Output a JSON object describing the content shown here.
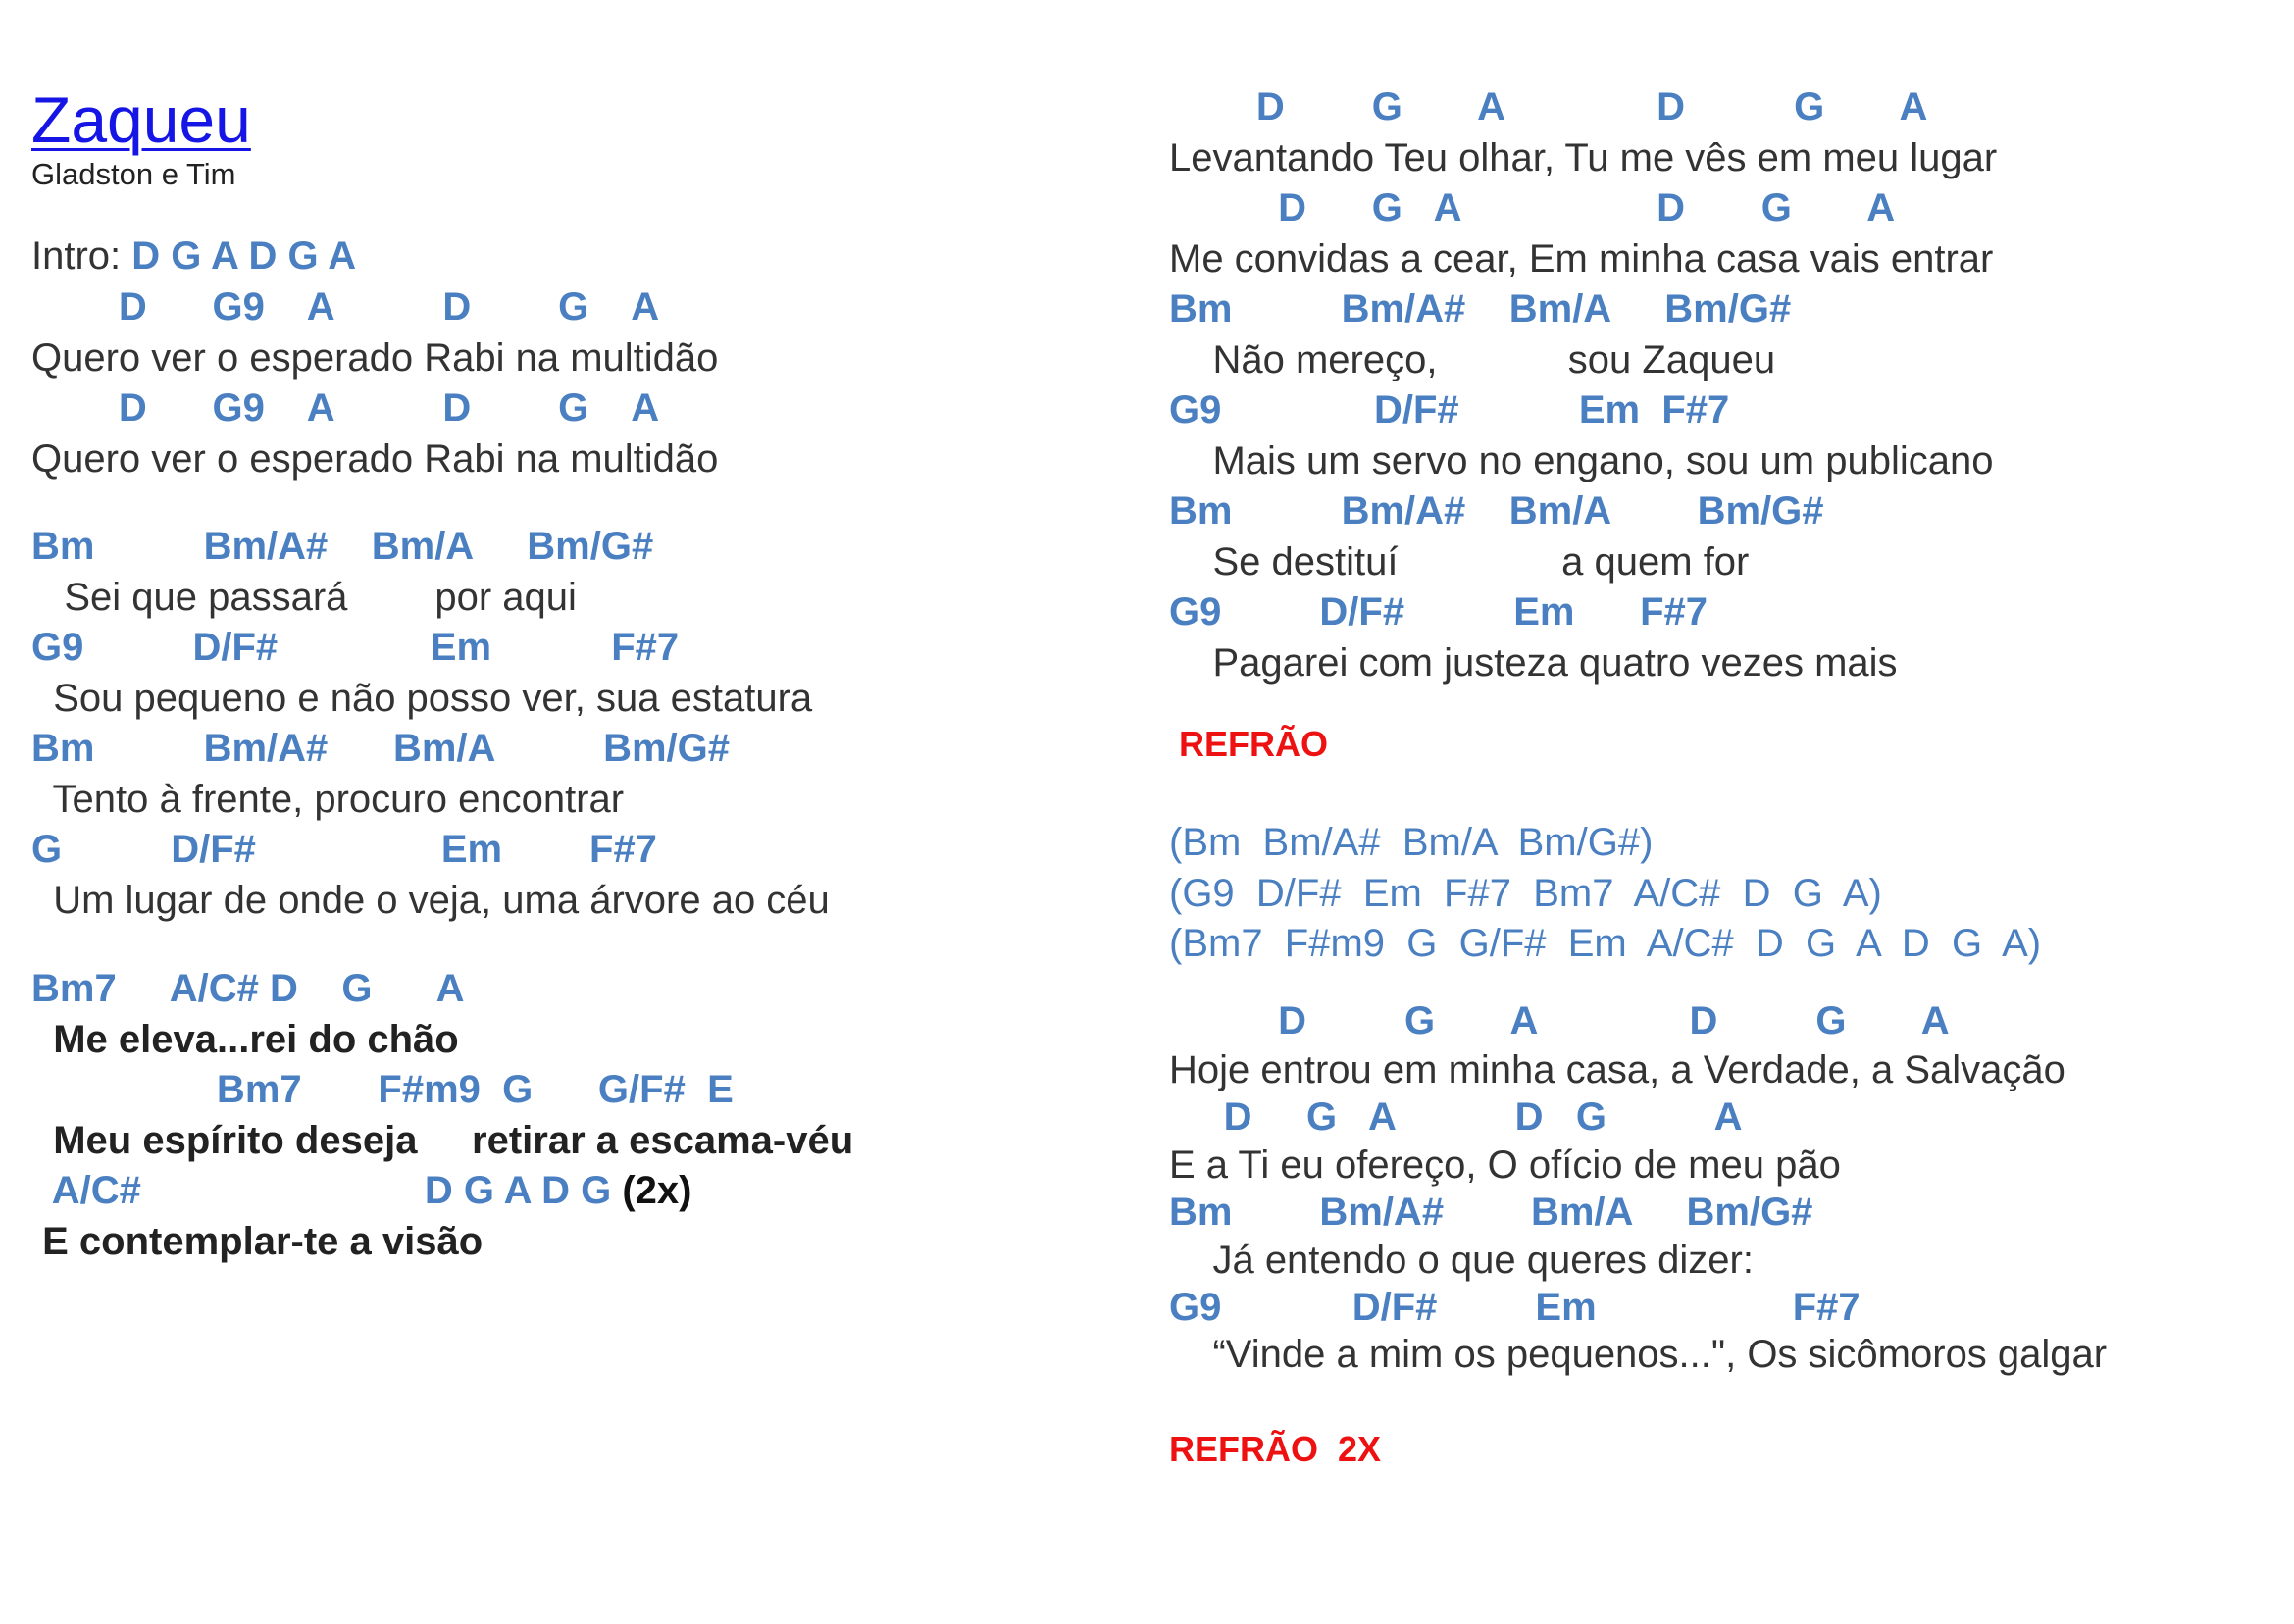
{
  "song": {
    "title": "Zaqueu",
    "artist": "Gladston e Tim"
  },
  "colors": {
    "chords": "#4a7fc1",
    "lyrics": "#333333",
    "title_link": "#1515e6",
    "section_marker": "#ee1111"
  },
  "left": {
    "intro_label": "Intro: ",
    "intro_chords": "D G A D G A",
    "v1_c1": "        D      G9    A          D        G    A",
    "v1_t1": "Quero ver o esperado Rabi na multidão",
    "v1_c2": "        D      G9    A          D        G    A",
    "v1_t2": "Quero ver o esperado Rabi na multidão",
    "v2_c1": "Bm          Bm/A#    Bm/A     Bm/G#",
    "v2_t1": "   Sei que passará        por aqui",
    "v2_c2": "G9          D/F#              Em           F#7",
    "v2_t2": "  Sou pequeno e não posso ver, sua estatura",
    "v2_c3": "Bm          Bm/A#      Bm/A          Bm/G#",
    "v2_t3": "  Tento à frente, procuro encontrar",
    "v2_c4": "G          D/F#                 Em        F#7",
    "v2_t4": "  Um lugar de onde o veja, uma árvore ao céu",
    "ch_c1": "Bm7     A/C# D    G      A",
    "ch_t1": "  Me eleva...rei do chão",
    "ch_c2": "                 Bm7       F#m9  G      G/F#  E",
    "ch_t2": "  Meu espírito deseja     retirar a escama-véu",
    "ch_c3_a": "  A/C#                          D G A D G ",
    "ch_c3_b": "(2x)",
    "ch_t3": " E contemplar-te a visão"
  },
  "right": {
    "v3_c1": "        D        G       A              D          G       A",
    "v3_t1": "Levantando Teu olhar, Tu me vês em meu lugar",
    "v3_c2": "          D      G   A                  D       G       A",
    "v3_t2": "Me convidas a cear, Em minha casa vais entrar",
    "v3_c3": "Bm          Bm/A#    Bm/A     Bm/G#",
    "v3_t3": "    Não mereço,            sou Zaqueu",
    "v3_c4": "G9              D/F#           Em  F#7",
    "v3_t4": "    Mais um servo no engano, sou um publicano",
    "v3_c5": "Bm          Bm/A#    Bm/A        Bm/G#",
    "v3_t5": "    Se destituí               a quem for",
    "v3_c6": "G9         D/F#          Em      F#7",
    "v3_t6": "    Pagarei com justeza quatro vezes mais",
    "refrao1": " REFRÃO",
    "inst1": "(Bm  Bm/A#  Bm/A  Bm/G#)",
    "inst2": "(G9  D/F#  Em  F#7  Bm7  A/C#  D  G  A)",
    "inst3": "(Bm7  F#m9  G  G/F#  Em  A/C#  D  G  A  D  G  A)",
    "v4_c1": "          D         G       A              D         G       A",
    "v4_t1": "Hoje entrou em minha casa, a Verdade, a Salvação",
    "v4_c2": "     D     G   A           D   G          A",
    "v4_t2": "E a Ti eu ofereço, O ofício de meu pão",
    "v4_c3": "Bm        Bm/A#        Bm/A     Bm/G#",
    "v4_t3": "    Já entendo o que queres dizer:",
    "v4_c4": "G9            D/F#         Em                  F#7",
    "v4_t4": "    “Vinde a mim os pequenos...\", Os sicômoros galgar",
    "refrao2": "REFRÃO  2X"
  }
}
